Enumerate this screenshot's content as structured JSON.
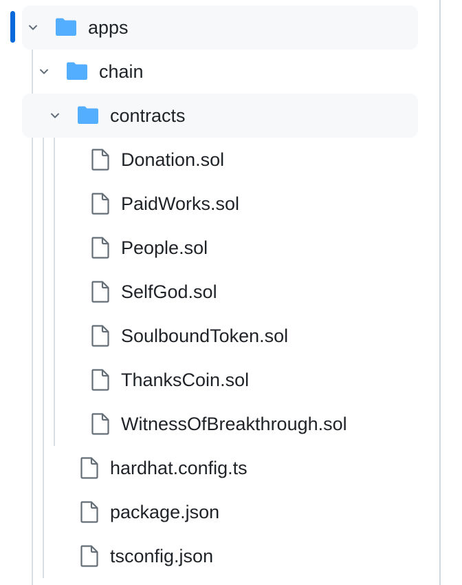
{
  "tree": {
    "apps": {
      "label": "apps",
      "icon": "folder-icon",
      "expanded": true
    },
    "chain": {
      "label": "chain",
      "icon": "folder-icon",
      "expanded": true
    },
    "contracts": {
      "label": "contracts",
      "icon": "folder-icon",
      "expanded": true
    },
    "contract_files": [
      {
        "label": "Donation.sol",
        "icon": "file-icon"
      },
      {
        "label": "PaidWorks.sol",
        "icon": "file-icon"
      },
      {
        "label": "People.sol",
        "icon": "file-icon"
      },
      {
        "label": "SelfGod.sol",
        "icon": "file-icon"
      },
      {
        "label": "SoulboundToken.sol",
        "icon": "file-icon"
      },
      {
        "label": "ThanksCoin.sol",
        "icon": "file-icon"
      },
      {
        "label": "WitnessOfBreakthrough.sol",
        "icon": "file-icon"
      }
    ],
    "chain_files": [
      {
        "label": "hardhat.config.ts",
        "icon": "file-icon"
      },
      {
        "label": "package.json",
        "icon": "file-icon"
      },
      {
        "label": "tsconfig.json",
        "icon": "file-icon"
      }
    ]
  },
  "colors": {
    "folder": "#54aeff",
    "file_outline": "#656d76",
    "active_indicator": "#0969da",
    "row_highlight": "#f6f8fa",
    "guide_line": "#d8dee4",
    "text": "#1f2328"
  }
}
